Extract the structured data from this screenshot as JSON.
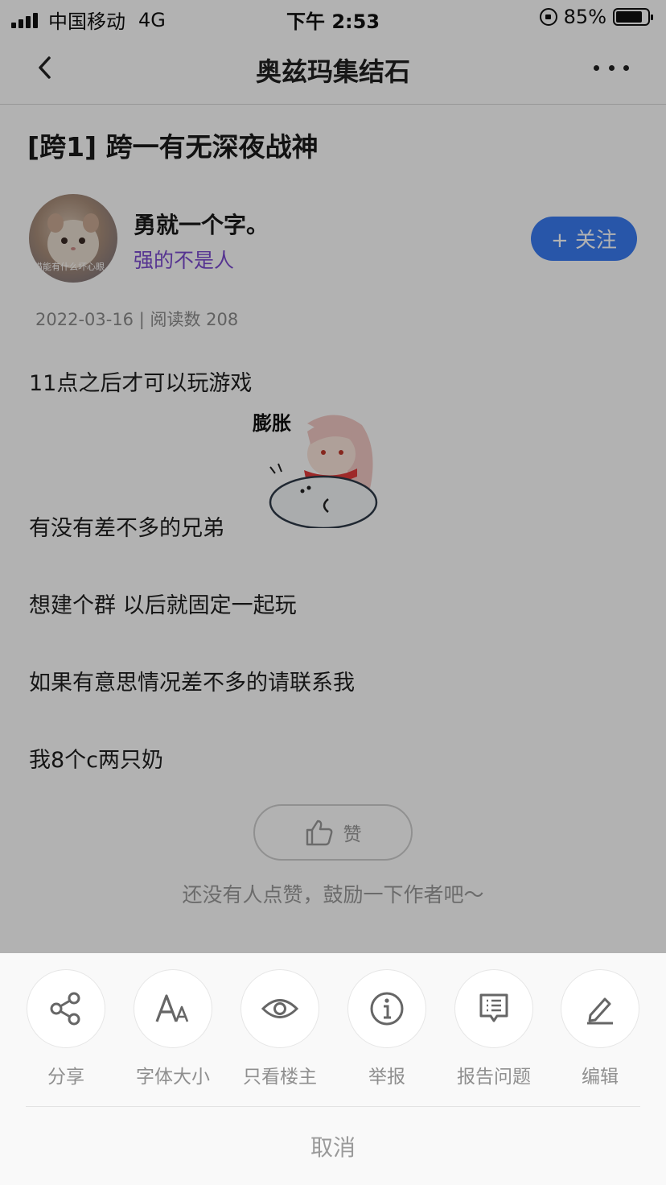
{
  "status_bar": {
    "carrier": "中国移动",
    "network": "4G",
    "time": "下午 2:53",
    "battery": "85%",
    "battery_level": 0.85
  },
  "navbar": {
    "title": "奥兹玛集结石",
    "back_icon": "chevron-left-icon",
    "more_icon": "more-dots-icon"
  },
  "post": {
    "title": "[跨1] 跨一有无深夜战神",
    "author": {
      "name": "勇就一个字。",
      "badge_title": "强的不是人",
      "avatar_caption": "猫能有什么坏心眼"
    },
    "follow_label": "+ 关注",
    "date": "2022-03-16",
    "views_label": "阅读数 208",
    "paragraphs": [
      "11点之后才可以玩游戏",
      "有没有差不多的兄弟",
      "想建个群 以后就固定一起玩",
      "如果有意思情况差不多的请联系我",
      "我8个c两只奶"
    ],
    "sticker_text": "膨胀",
    "like_label": "赞",
    "like_hint": "还没有人点赞，鼓励一下作者吧～"
  },
  "action_sheet": {
    "items": [
      {
        "label": "分享",
        "icon": "share-icon"
      },
      {
        "label": "字体大小",
        "icon": "font-size-icon"
      },
      {
        "label": "只看楼主",
        "icon": "eye-icon"
      },
      {
        "label": "举报",
        "icon": "info-icon"
      },
      {
        "label": "报告问题",
        "icon": "report-icon"
      },
      {
        "label": "编辑",
        "icon": "pencil-icon"
      }
    ],
    "cancel_label": "取消"
  },
  "colors": {
    "accent_blue": "#3a7bf2",
    "title_purple": "#7c4bd0"
  }
}
